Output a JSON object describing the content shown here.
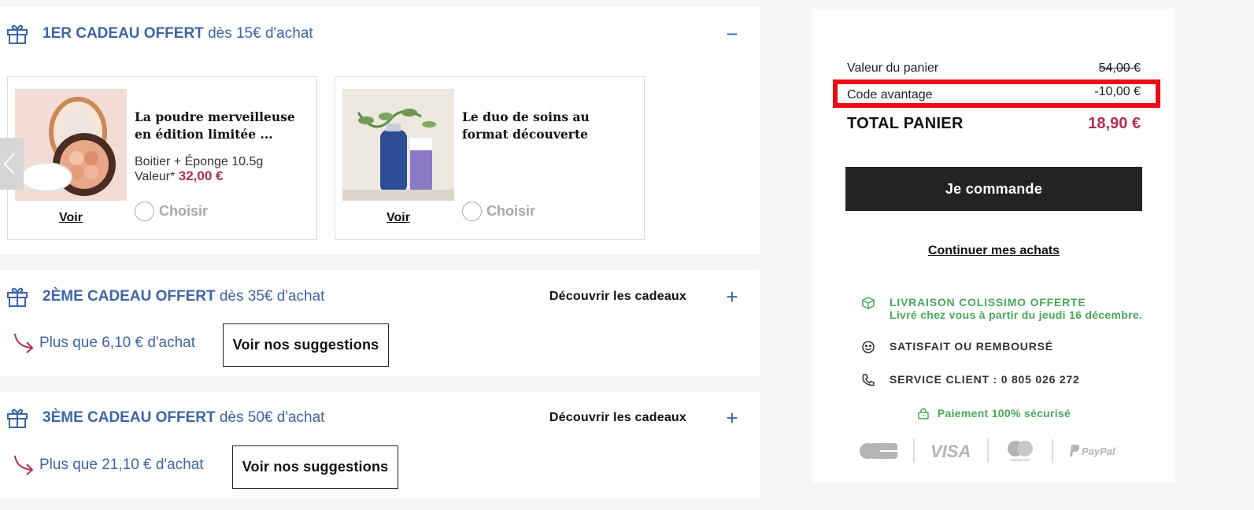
{
  "gifts": [
    {
      "title_bold": "1ER CADEAU OFFERT",
      "title_rest": "dès 15€ d'achat",
      "toggle": "−",
      "products": [
        {
          "name": "La poudre merveilleuse en édition limitée ...",
          "desc": "Boitier + Éponge 10.5g",
          "value_label": "Valeur*",
          "value": "32,00 €",
          "voir": "Voir",
          "choose": "Choisir"
        },
        {
          "name": "Le duo de soins au format découverte",
          "voir": "Voir",
          "choose": "Choisir"
        }
      ]
    },
    {
      "title_bold": "2ÈME CADEAU OFFERT",
      "title_rest": "dès 35€ d'achat",
      "discover": "Découvrir les cadeaux",
      "toggle": "+",
      "remaining": "Plus que 6,10 € d'achat",
      "suggest": "Voir nos suggestions"
    },
    {
      "title_bold": "3ÈME CADEAU OFFERT",
      "title_rest": "dès 50€ d'achat",
      "discover": "Découvrir les cadeaux",
      "toggle": "+",
      "remaining": "Plus que 21,10 € d'achat",
      "suggest": "Voir nos suggestions"
    }
  ],
  "summary": {
    "basket_label": "Valeur du panier",
    "basket_value": "54,00 €",
    "code_label": "Code avantage",
    "code_value": "-10,00 €",
    "total_label": "TOTAL PANIER",
    "total_value": "18,90 €",
    "cta": "Je commande",
    "continue": "Continuer mes achats",
    "delivery_title": "LIVRAISON COLISSIMO OFFERTE",
    "delivery_sub": "Livré chez vous à partir du jeudi 16 décembre.",
    "satisfied": "SATISFAIT OU REMBOURSÉ",
    "service": "SERVICE CLIENT : 0 805 026 272",
    "secure": "Paiement 100% sécurisé",
    "payments": [
      "CB",
      "VISA",
      "mastercard",
      "PayPal"
    ]
  },
  "colors": {
    "blue": "#3d65a5",
    "accent": "#b1304d",
    "green": "#48a85a",
    "highlight": "#ee0b14",
    "dark": "#232323"
  }
}
